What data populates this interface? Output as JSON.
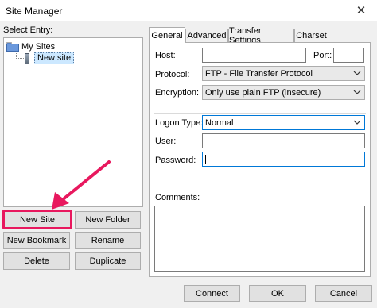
{
  "window": {
    "title": "Site Manager",
    "close_glyph": "✕"
  },
  "left": {
    "select_label": "Select Entry:",
    "tree": {
      "root": "My Sites",
      "child": "New site"
    },
    "buttons": {
      "new_site": "New Site",
      "new_folder": "New Folder",
      "new_bookmark": "New Bookmark",
      "rename": "Rename",
      "delete": "Delete",
      "duplicate": "Duplicate"
    }
  },
  "tabs": [
    "General",
    "Advanced",
    "Transfer Settings",
    "Charset"
  ],
  "general": {
    "host_label": "Host:",
    "host_value": "",
    "port_label": "Port:",
    "port_value": "",
    "protocol_label": "Protocol:",
    "protocol_value": "FTP - File Transfer Protocol",
    "encryption_label": "Encryption:",
    "encryption_value": "Only use plain FTP (insecure)",
    "logon_type_label": "Logon Type:",
    "logon_type_value": "Normal",
    "user_label": "User:",
    "user_value": "",
    "password_label": "Password:",
    "password_value": "",
    "comments_label": "Comments:",
    "comments_value": ""
  },
  "footer": {
    "connect": "Connect",
    "ok": "OK",
    "cancel": "Cancel"
  },
  "colors": {
    "highlight": "#e8185e",
    "focus": "#0078d7",
    "selection": "#cce8ff"
  },
  "icons": [
    "close-icon",
    "folder-icon",
    "site-icon",
    "chevron-down-icon",
    "arrow-annotation"
  ]
}
